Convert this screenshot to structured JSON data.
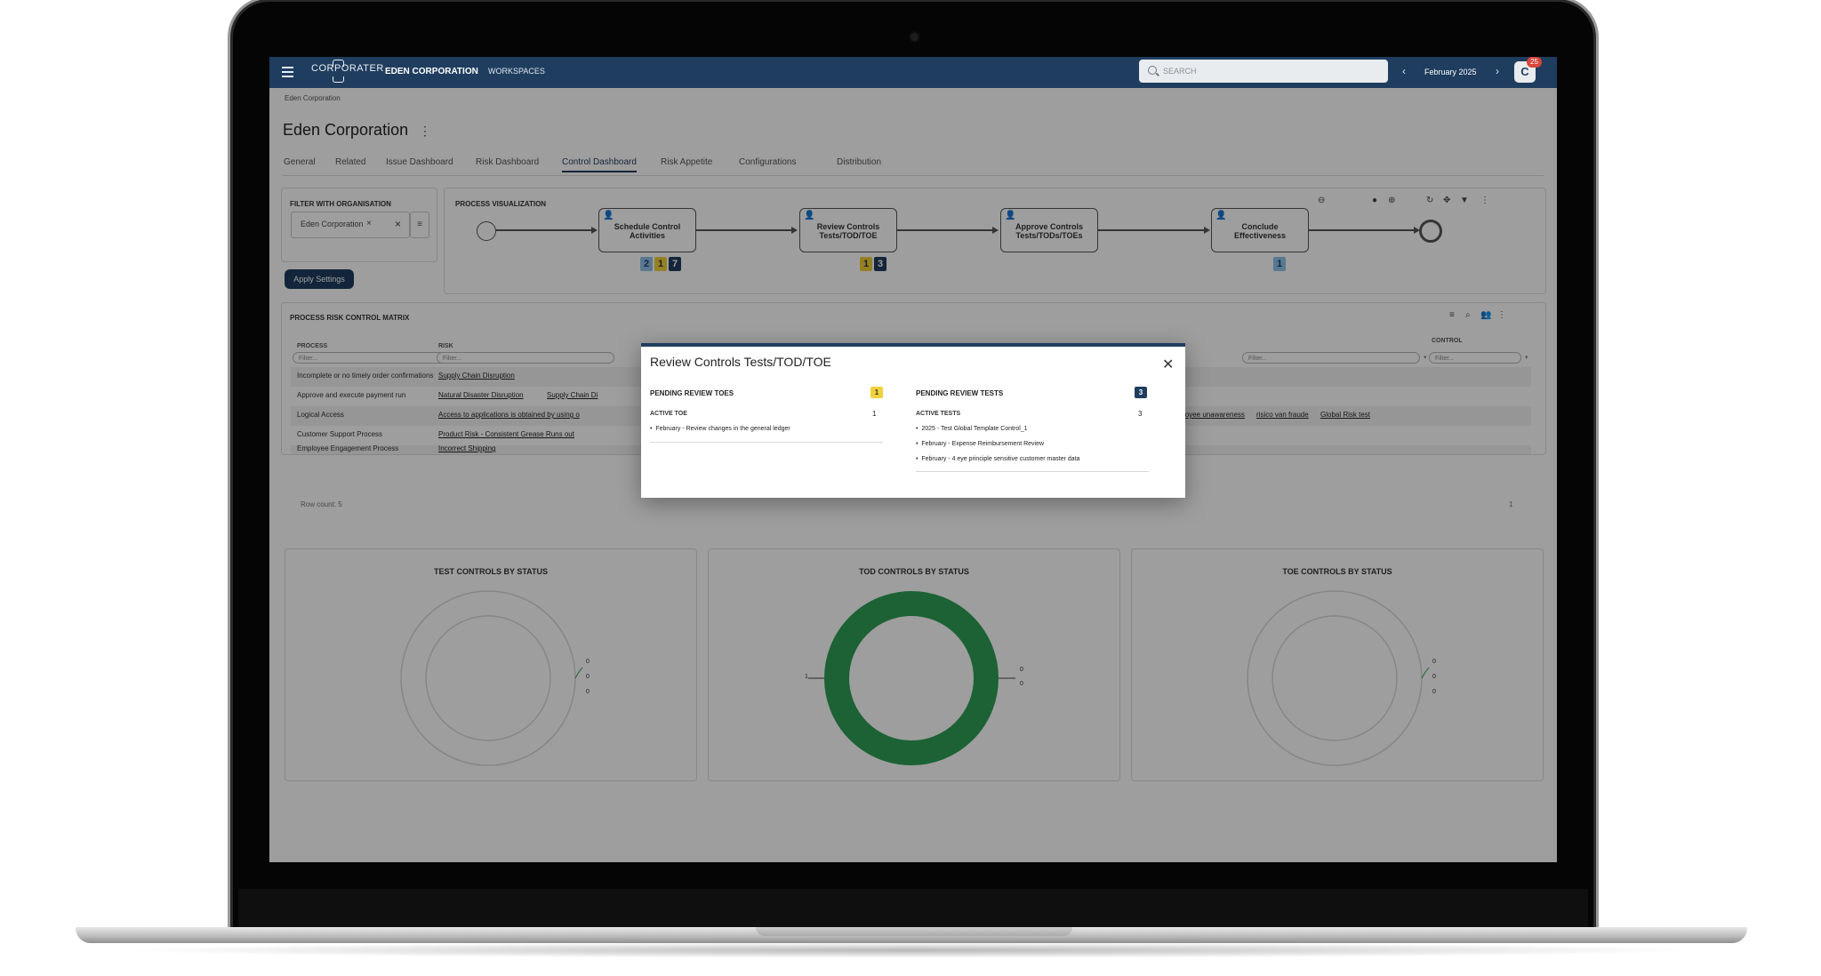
{
  "topbar": {
    "logo": "CORPORATER",
    "org": "EDEN CORPORATION",
    "workspaces": "WORKSPACES",
    "search_placeholder": "SEARCH",
    "date": "February 2025",
    "prev_icon": "chevron-left-icon",
    "next_icon": "chevron-right-icon",
    "avatar_initial": "C",
    "notifications": "25"
  },
  "breadcrumb": "Eden Corporation",
  "page_title": "Eden Corporation",
  "tabs": [
    "General",
    "Related",
    "Issue Dashboard",
    "Risk Dashboard",
    "Control Dashboard",
    "Risk Appetite",
    "Configurations",
    "Distribution"
  ],
  "active_tab": "Control Dashboard",
  "filter": {
    "title": "FILTER WITH ORGANISATION",
    "selected": "Eden Corporation",
    "apply": "Apply Settings"
  },
  "process": {
    "title": "PROCESS VISUALIZATION",
    "tasks": [
      {
        "label_line1": "Schedule Control",
        "label_line2": "Activities",
        "badges": [
          "2",
          "1",
          "7"
        ]
      },
      {
        "label_line1": "Review Controls",
        "label_line2": "Tests/TOD/TOE",
        "badges": [
          "1",
          "3"
        ]
      },
      {
        "label_line1": "Approve Controls",
        "label_line2": "Tests/TODs/TOEs",
        "badges": []
      },
      {
        "label_line1": "Conclude",
        "label_line2": "Effectiveness",
        "badges": [
          "1"
        ]
      }
    ]
  },
  "matrix": {
    "title": "PROCESS RISK CONTROL MATRIX",
    "columns": {
      "process": "PROCESS",
      "risk": "RISK",
      "control": "CONTROL"
    },
    "filter_placeholder": "Filter...",
    "rows": [
      {
        "process": "Incomplete or no timely order confirmations",
        "risk": "Supply Chain Disruption",
        "control": ""
      },
      {
        "process": "Approve and execute payment run",
        "risk": "Natural Disaster Disruption",
        "risk2": "Supply Chain Di",
        "control": ""
      },
      {
        "process": "Logical Access",
        "risk": "Access to applications is obtained by using o",
        "control": "loyee unawareness",
        "control2": "risico van fraude",
        "control3": "Global Risk test"
      },
      {
        "process": "Customer Support Process",
        "risk": "Product Risk - Consistent Grease Runs out",
        "control": ""
      },
      {
        "process": "Employee Engagement Process",
        "risk": "Incorrect Shipping",
        "control": ""
      }
    ],
    "row_count": "Row count: 5",
    "page": "1"
  },
  "charts": {
    "test": {
      "title": "TEST CONTROLS BY STATUS",
      "legend": [
        "0",
        "0",
        "0"
      ]
    },
    "tod": {
      "title": "TOD CONTROLS BY STATUS",
      "left_value": "1",
      "legend": [
        "0",
        "0"
      ]
    },
    "toe": {
      "title": "TOE CONTROLS BY STATUS",
      "legend": [
        "0",
        "0",
        "0"
      ]
    }
  },
  "chart_data": [
    {
      "type": "pie",
      "title": "TEST CONTROLS BY STATUS",
      "values": [
        0,
        0,
        0
      ]
    },
    {
      "type": "pie",
      "title": "TOD CONTROLS BY STATUS",
      "values": [
        1,
        0,
        0
      ],
      "colors": [
        "#2e9e55"
      ]
    },
    {
      "type": "pie",
      "title": "TOE CONTROLS BY STATUS",
      "values": [
        0,
        0,
        0
      ]
    }
  ],
  "modal": {
    "title": "Review Controls Tests/TOD/TOE",
    "left": {
      "heading": "PENDING REVIEW TOES",
      "badge": "1",
      "sub": "ACTIVE TOE",
      "count": "1",
      "items": [
        "February - Review changes in the general ledger"
      ]
    },
    "right": {
      "heading": "PENDING REVIEW TESTS",
      "badge": "3",
      "sub": "ACTIVE TESTS",
      "count": "3",
      "items": [
        "2025 - Test Global Template Control_1",
        "February - Expense Reimbursement Review",
        "February - 4 eye principle sensitive customer master data"
      ]
    }
  },
  "colors": {
    "brand": "#1f3d5e",
    "success": "#2e9e55",
    "warning": "#f1d13c",
    "info": "#8fc3e8"
  }
}
